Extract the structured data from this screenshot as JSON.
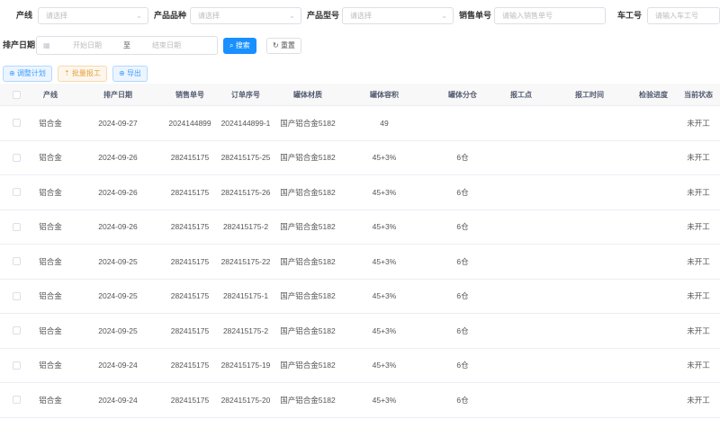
{
  "filters": {
    "line_label": "产线",
    "line_placeholder": "请选择",
    "variety_label": "产品品种",
    "variety_placeholder": "请选择",
    "model_label": "产品型号",
    "model_placeholder": "请选择",
    "sales_label": "销售单号",
    "sales_placeholder": "请输入销售单号",
    "workno_label": "车工号",
    "workno_placeholder": "请输入车工号",
    "date_label": "排产日期",
    "date_start": "开始日期",
    "date_sep": "至",
    "date_end": "结束日期"
  },
  "actions": {
    "search": "搜索",
    "reset": "重置",
    "adjust_plan": "调整计划",
    "batch_report": "批量报工",
    "export": "导出"
  },
  "table": {
    "headers": [
      "产线",
      "排产日期",
      "销售单号",
      "订单序号",
      "罐体材质",
      "罐体容积",
      "罐体分仓",
      "报工点",
      "报工时间",
      "检验进度",
      "当前状态"
    ],
    "rows": [
      {
        "line": "铝合金",
        "date": "2024-09-27",
        "sales": "2024144899",
        "order": "2024144899-1",
        "material": "国产铝合金5182",
        "volume": "49",
        "compartment": "",
        "status": "未开工"
      },
      {
        "line": "铝合金",
        "date": "2024-09-26",
        "sales": "282415175",
        "order": "282415175-25",
        "material": "国产铝合金5182",
        "volume": "45+3%",
        "compartment": "6仓",
        "status": "未开工"
      },
      {
        "line": "铝合金",
        "date": "2024-09-26",
        "sales": "282415175",
        "order": "282415175-26",
        "material": "国产铝合金5182",
        "volume": "45+3%",
        "compartment": "6仓",
        "status": "未开工"
      },
      {
        "line": "铝合金",
        "date": "2024-09-26",
        "sales": "282415175",
        "order": "282415175-2",
        "material": "国产铝合金5182",
        "volume": "45+3%",
        "compartment": "6仓",
        "status": "未开工"
      },
      {
        "line": "铝合金",
        "date": "2024-09-25",
        "sales": "282415175",
        "order": "282415175-22",
        "material": "国产铝合金5182",
        "volume": "45+3%",
        "compartment": "6仓",
        "status": "未开工"
      },
      {
        "line": "铝合金",
        "date": "2024-09-25",
        "sales": "282415175",
        "order": "282415175-1",
        "material": "国产铝合金5182",
        "volume": "45+3%",
        "compartment": "6仓",
        "status": "未开工"
      },
      {
        "line": "铝合金",
        "date": "2024-09-25",
        "sales": "282415175",
        "order": "282415175-2",
        "material": "国产铝合金5182",
        "volume": "45+3%",
        "compartment": "6仓",
        "status": "未开工"
      },
      {
        "line": "铝合金",
        "date": "2024-09-24",
        "sales": "282415175",
        "order": "282415175-19",
        "material": "国产铝合金5182",
        "volume": "45+3%",
        "compartment": "6仓",
        "status": "未开工"
      },
      {
        "line": "铝合金",
        "date": "2024-09-24",
        "sales": "282415175",
        "order": "282415175-20",
        "material": "国产铝合金5182",
        "volume": "45+3%",
        "compartment": "6仓",
        "status": "未开工"
      }
    ]
  }
}
